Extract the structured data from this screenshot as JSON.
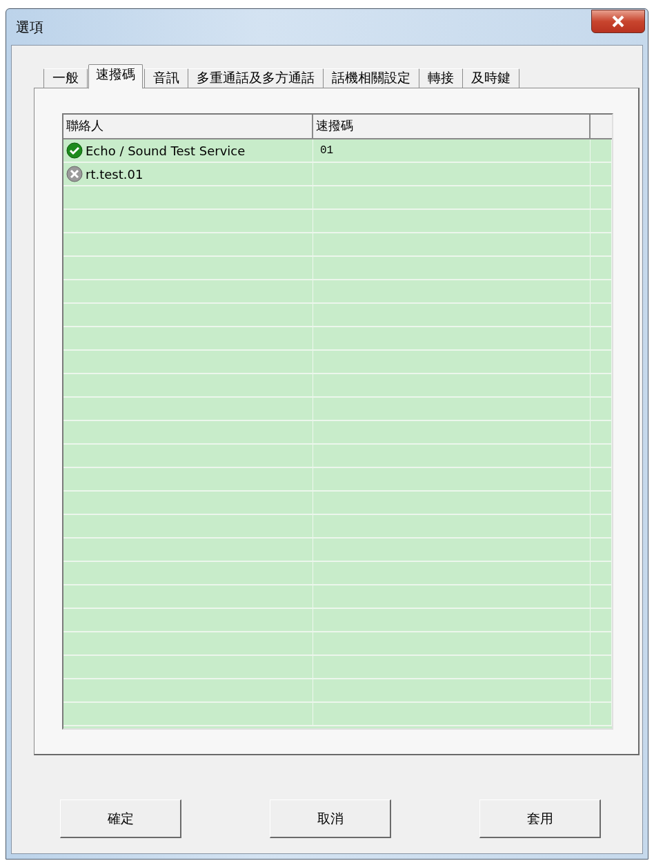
{
  "window": {
    "title": "選項"
  },
  "tabs": [
    {
      "label": "一般",
      "selected": false
    },
    {
      "label": "速撥碼",
      "selected": true
    },
    {
      "label": "音訊",
      "selected": false
    },
    {
      "label": "多重通話及多方通話",
      "selected": false
    },
    {
      "label": "話機相關設定",
      "selected": false
    },
    {
      "label": "轉接",
      "selected": false
    },
    {
      "label": "及時鍵",
      "selected": false
    }
  ],
  "table": {
    "columns": [
      "聯絡人",
      "速撥碼"
    ],
    "rows": [
      {
        "online": true,
        "contact": "Echo / Sound Test Service",
        "speed_dial": "01"
      },
      {
        "online": false,
        "contact": "rt.test.01",
        "speed_dial": ""
      }
    ]
  },
  "buttons": [
    "確定",
    "取消",
    "套用"
  ]
}
